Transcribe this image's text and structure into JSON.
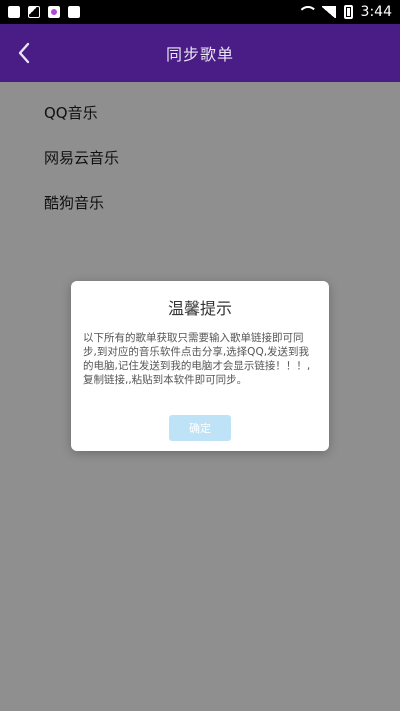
{
  "status_bar": {
    "time": "3:44",
    "icons": [
      "notification-icon",
      "image-icon",
      "app-icon",
      "notification-icon"
    ]
  },
  "header": {
    "title": "同步歌单",
    "back_icon": "chevron-left-icon"
  },
  "list": {
    "items": [
      {
        "label": "QQ音乐"
      },
      {
        "label": "网易云音乐"
      },
      {
        "label": "酷狗音乐"
      }
    ]
  },
  "dialog": {
    "title": "温馨提示",
    "message": "以下所有的歌单获取只需要输入歌单链接即可同步,到对应的音乐软件点击分享,选择QQ,发送到我的电脑,记住发送到我的电脑才会显示链接！！！,复制链接,,粘贴到本软件即可同步。",
    "confirm_label": "确定"
  },
  "colors": {
    "app_bar": "#4a1c86",
    "background": "#8f8f8f",
    "confirm_button": "#bfe3f6"
  }
}
